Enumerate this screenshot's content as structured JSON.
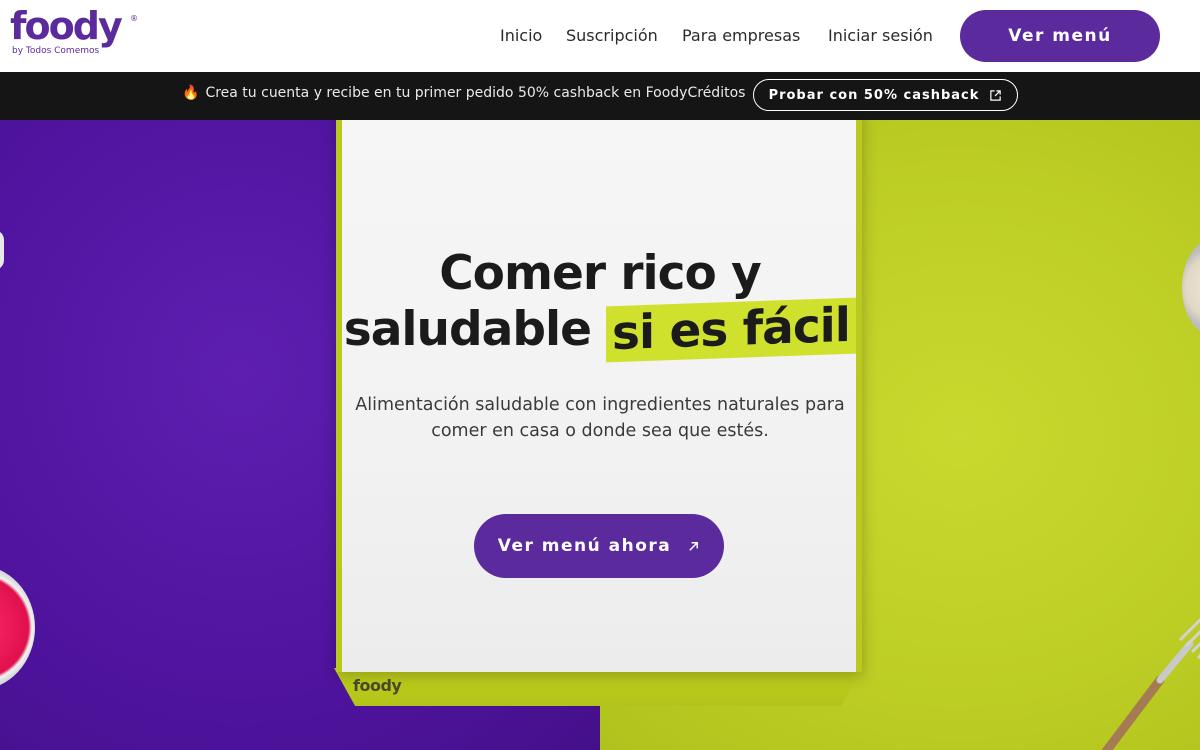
{
  "header": {
    "logo_text": "foody",
    "logo_subtitle": "by Todos Comemos",
    "nav": [
      {
        "label": "Inicio"
      },
      {
        "label": "Suscripción"
      },
      {
        "label": "Para empresas"
      },
      {
        "label": "Iniciar sesión"
      }
    ],
    "cta_label": "Ver menú"
  },
  "promo": {
    "icon": "fire-icon",
    "text": "Crea tu cuenta y recibe en tu primer pedido 50% cashback en FoodyCréditos",
    "button_label": "Probar con 50% cashback",
    "button_icon": "external-link-icon"
  },
  "hero": {
    "headline_line1": "Comer rico y",
    "headline_line2_plain": "saludable",
    "headline_line2_highlight": "si es fácil",
    "subtext": "Alimentación saludable con ingredientes naturales para comer en casa o donde sea que estés.",
    "cta_label": "Ver menú ahora",
    "cta_icon": "arrow-up-right-icon",
    "box_logo": "foody"
  },
  "colors": {
    "brand_purple": "#5b2a9c",
    "lime": "#c9d92e",
    "promo_bg": "#151515"
  }
}
